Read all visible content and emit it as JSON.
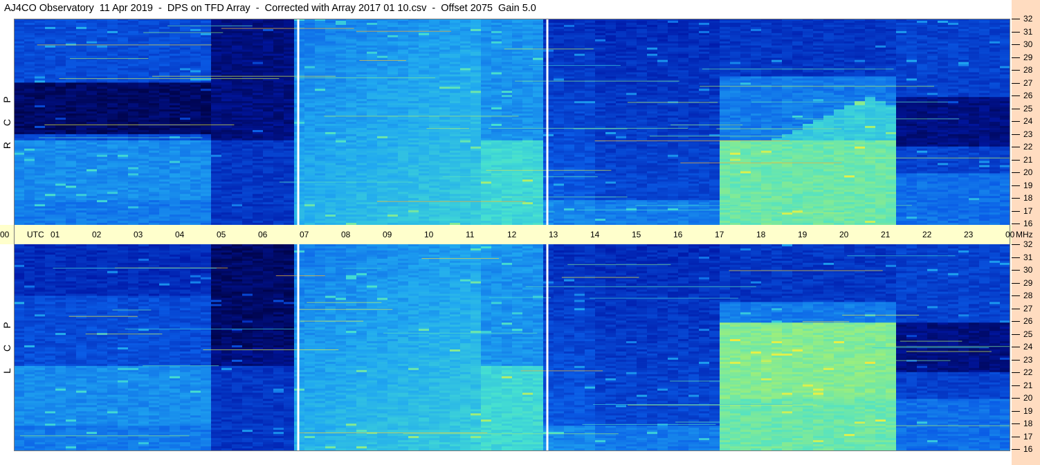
{
  "title": "AJ4CO Observatory  11 Apr 2019  -  DPS on TFD Array  -  Corrected with Array 2017 01 10.csv  -  Offset 2075  Gain 5.0",
  "chart_data": [
    {
      "type": "heatmap",
      "name": "R C P",
      "polarization_letters": [
        "R",
        "C",
        "P"
      ],
      "xlabel": "UTC",
      "ylabel": "MHz",
      "x_ticks": [
        "00",
        "01",
        "02",
        "03",
        "04",
        "05",
        "06",
        "07",
        "08",
        "09",
        "10",
        "11",
        "12",
        "13",
        "14",
        "15",
        "16",
        "17",
        "18",
        "19",
        "20",
        "21",
        "22",
        "23",
        "00"
      ],
      "xlim": [
        0,
        24
      ],
      "y_ticks": [
        "32",
        "31",
        "30",
        "29",
        "28",
        "27",
        "26",
        "25",
        "24",
        "23",
        "22",
        "21",
        "20",
        "19",
        "18",
        "17",
        "16"
      ],
      "ylim": [
        16,
        32
      ],
      "gaps_utc": [
        6.85,
        12.85
      ],
      "colormap": [
        "#00003a",
        "#0018a8",
        "#0a5ce6",
        "#20a8f0",
        "#46e0d0",
        "#a8f070",
        "#f0f040",
        "#ff8020",
        "#ff2010"
      ]
    },
    {
      "type": "heatmap",
      "name": "L C P",
      "polarization_letters": [
        "L",
        "C",
        "P"
      ],
      "xlabel": "UTC",
      "ylabel": "MHz",
      "x_ticks": [
        "00",
        "01",
        "02",
        "03",
        "04",
        "05",
        "06",
        "07",
        "08",
        "09",
        "10",
        "11",
        "12",
        "13",
        "14",
        "15",
        "16",
        "17",
        "18",
        "19",
        "20",
        "21",
        "22",
        "23",
        "00"
      ],
      "xlim": [
        0,
        24
      ],
      "y_ticks": [
        "32",
        "31",
        "30",
        "29",
        "28",
        "27",
        "26",
        "25",
        "24",
        "23",
        "22",
        "21",
        "20",
        "19",
        "18",
        "17",
        "16"
      ],
      "ylim": [
        16,
        32
      ],
      "gaps_utc": [
        6.85,
        12.85
      ],
      "colormap": [
        "#00003a",
        "#0018a8",
        "#0a5ce6",
        "#20a8f0",
        "#46e0d0",
        "#a8f070",
        "#f0f040",
        "#ff8020",
        "#ff2010"
      ]
    }
  ],
  "time_axis": {
    "labels": [
      "00",
      "UTC",
      "01",
      "02",
      "03",
      "04",
      "05",
      "06",
      "07",
      "08",
      "09",
      "10",
      "11",
      "12",
      "13",
      "14",
      "15",
      "16",
      "17",
      "18",
      "19",
      "20",
      "21",
      "22",
      "23",
      "00",
      "MHz"
    ]
  }
}
